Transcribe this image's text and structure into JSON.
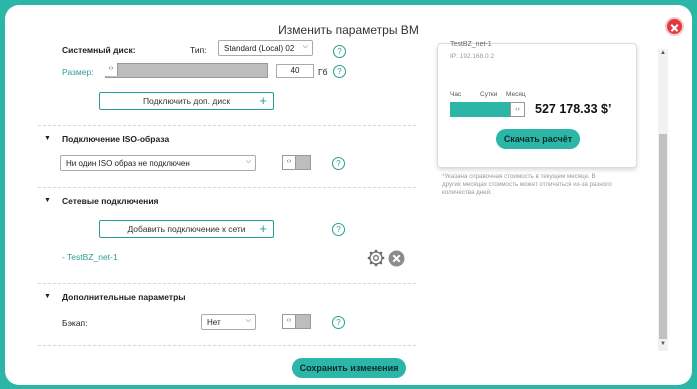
{
  "dialog": {
    "title": "Изменить параметры ВМ"
  },
  "disk": {
    "label": "Системный диск:",
    "type_label": "Тип:",
    "type_value": "Standard (Local) 02",
    "size_label": "Размер:",
    "size_value": "40",
    "size_unit": "Гб",
    "add_disk_label": "Подключить доп. диск"
  },
  "iso": {
    "section_title": "Подключение ISO-образа",
    "select_value": "Ни один ISO образ не подключен"
  },
  "network": {
    "section_title": "Сетевые подключения",
    "add_label": "Добавить подключение к сети",
    "item": "- TestBZ_net-1"
  },
  "extra": {
    "section_title": "Дополнительные параметры",
    "backup_label": "Бэкап:",
    "backup_value": "Нет"
  },
  "save_label": "Сохранить изменения",
  "summary": {
    "name": "TestBZ_net-1",
    "ip": "IP: 192.168.0.2",
    "period_tabs": [
      "Час",
      "Сутки",
      "Месяц"
    ],
    "price": "527 178.33 $’",
    "download_label": "Скачать расчёт",
    "footnote_1": "*Указана справочная стоимость в текущем месяце. В",
    "footnote_2": "других месяцах стоимость может отличаться из-за разного",
    "footnote_3": "количества дней."
  },
  "glyphs": {
    "help": "?",
    "plus": "+",
    "chevron": "⌵",
    "collapse": "▼",
    "knob": "‹›"
  }
}
